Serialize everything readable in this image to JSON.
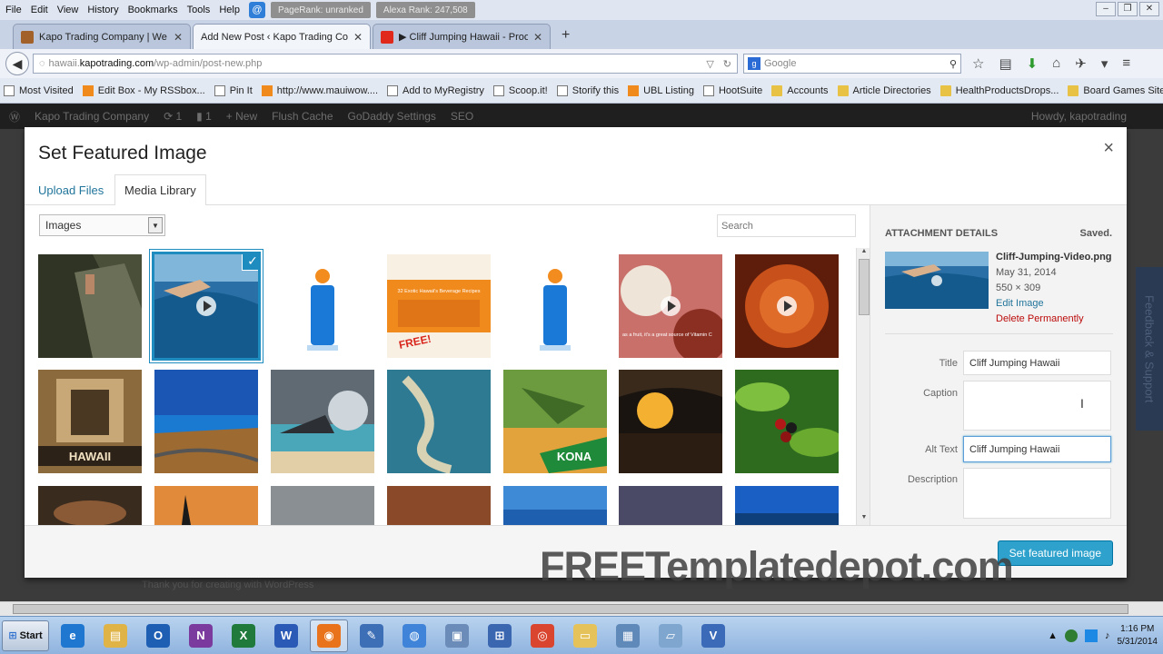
{
  "menubar": {
    "items": [
      "File",
      "Edit",
      "View",
      "History",
      "Bookmarks",
      "Tools",
      "Help"
    ],
    "pagerank": "PageRank: unranked",
    "alexa": "Alexa Rank: 247,508"
  },
  "tabs": [
    {
      "label": "Kapo Trading Company | We ...",
      "color": "#a3612a"
    },
    {
      "label": "Add New Post ‹ Kapo Trading Com...",
      "color": "#dfe6f2"
    },
    {
      "label": "▶ Cliff Jumping Hawaii - Proo ...",
      "color": "#e0281b"
    }
  ],
  "navbar": {
    "url_prefix": "hawaii.",
    "url_host": "kapotrading.com",
    "url_path": "/wp-admin/post-new.php",
    "search_placeholder": "Google"
  },
  "bookmarks": [
    {
      "label": "Most Visited",
      "icon": "page"
    },
    {
      "label": "Edit Box - My RSSbox...",
      "icon": "rss"
    },
    {
      "label": "Pin It",
      "icon": "page"
    },
    {
      "label": "http://www.mauiwow....",
      "icon": "rss"
    },
    {
      "label": "Add to MyRegistry",
      "icon": "page"
    },
    {
      "label": "Scoop.it!",
      "icon": "page"
    },
    {
      "label": "Storify this",
      "icon": "page"
    },
    {
      "label": "UBL Listing",
      "icon": "rss"
    },
    {
      "label": "HootSuite",
      "icon": "page"
    },
    {
      "label": "Accounts",
      "icon": "folder"
    },
    {
      "label": "Article Directories",
      "icon": "folder"
    },
    {
      "label": "HealthProductsDrops...",
      "icon": "folder"
    },
    {
      "label": "Board Games Sites",
      "icon": "folder"
    }
  ],
  "adminbar": {
    "site": "Kapo Trading Company",
    "updates": "1",
    "comments": "1",
    "new": "New",
    "flush": "Flush Cache",
    "godaddy": "GoDaddy Settings",
    "seo": "SEO",
    "howdy": "Howdy, kapotrading"
  },
  "feedback_tab": "Feedback & Support",
  "wp_footer_text": "Thank you for creating with WordPress",
  "modal": {
    "title": "Set Featured Image",
    "close": "×",
    "tab_upload": "Upload Files",
    "tab_library": "Media Library",
    "filter_value": "Images",
    "search_placeholder": "Search",
    "button_label": "Set featured image"
  },
  "details": {
    "heading": "ATTACHMENT DETAILS",
    "saved": "Saved.",
    "filename": "Cliff-Jumping-Video.png",
    "date": "May 31, 2014",
    "dimensions": "550 × 309",
    "edit_link": "Edit Image",
    "delete_link": "Delete Permanently",
    "title_label": "Title",
    "title_value": "Cliff Jumping Hawaii",
    "caption_label": "Caption",
    "caption_value": "",
    "alt_label": "Alt Text",
    "alt_value": "Cliff Jumping Hawaii",
    "description_label": "Description",
    "description_value": ""
  },
  "thumb_text": {
    "hawaii_sign": "HAWAII",
    "kona": "KONA",
    "recipes_title": "32 Exotic Hawaii's Beverage Recipes",
    "recipes_stamp": "FREE!",
    "vitamin_text": "as a fruit, it's a great source of Vitamin C"
  },
  "watermark": "FREETemplatedepot.com",
  "taskbar": {
    "start": "Start",
    "apps": [
      {
        "name": "ie-icon",
        "glyph": "e",
        "color": "#1f77d0"
      },
      {
        "name": "explorer-icon",
        "glyph": "▤",
        "color": "#e0b347"
      },
      {
        "name": "outlook-icon",
        "glyph": "O",
        "color": "#1e5fb4"
      },
      {
        "name": "onenote-icon",
        "glyph": "N",
        "color": "#7b3b9e"
      },
      {
        "name": "excel-icon",
        "glyph": "X",
        "color": "#1f7a3b"
      },
      {
        "name": "word-icon",
        "glyph": "W",
        "color": "#2a5ab5"
      },
      {
        "name": "firefox-icon",
        "glyph": "◉",
        "color": "#e8731c"
      },
      {
        "name": "paint-icon",
        "glyph": "✎",
        "color": "#3d6fb6"
      },
      {
        "name": "globe-icon",
        "glyph": "◍",
        "color": "#3f84d8"
      },
      {
        "name": "cube-icon",
        "glyph": "▣",
        "color": "#6b8bb8"
      },
      {
        "name": "network-icon",
        "glyph": "⊞",
        "color": "#3b66b0"
      },
      {
        "name": "chrome-icon",
        "glyph": "◎",
        "color": "#d9452f"
      },
      {
        "name": "folder-icon",
        "glyph": "▭",
        "color": "#e6c35a"
      },
      {
        "name": "screen-icon",
        "glyph": "▦",
        "color": "#5f89b9"
      },
      {
        "name": "tablet-icon",
        "glyph": "▱",
        "color": "#7fa6cf"
      },
      {
        "name": "v-icon",
        "glyph": "V",
        "color": "#3a6ab8"
      }
    ],
    "time": "1:16 PM",
    "date": "5/31/2014"
  },
  "colors": {
    "wp_blue": "#21759b",
    "button_blue": "#2ea2cc",
    "selection_blue": "#1e8cbe",
    "delete_red": "#bc0b0b"
  }
}
